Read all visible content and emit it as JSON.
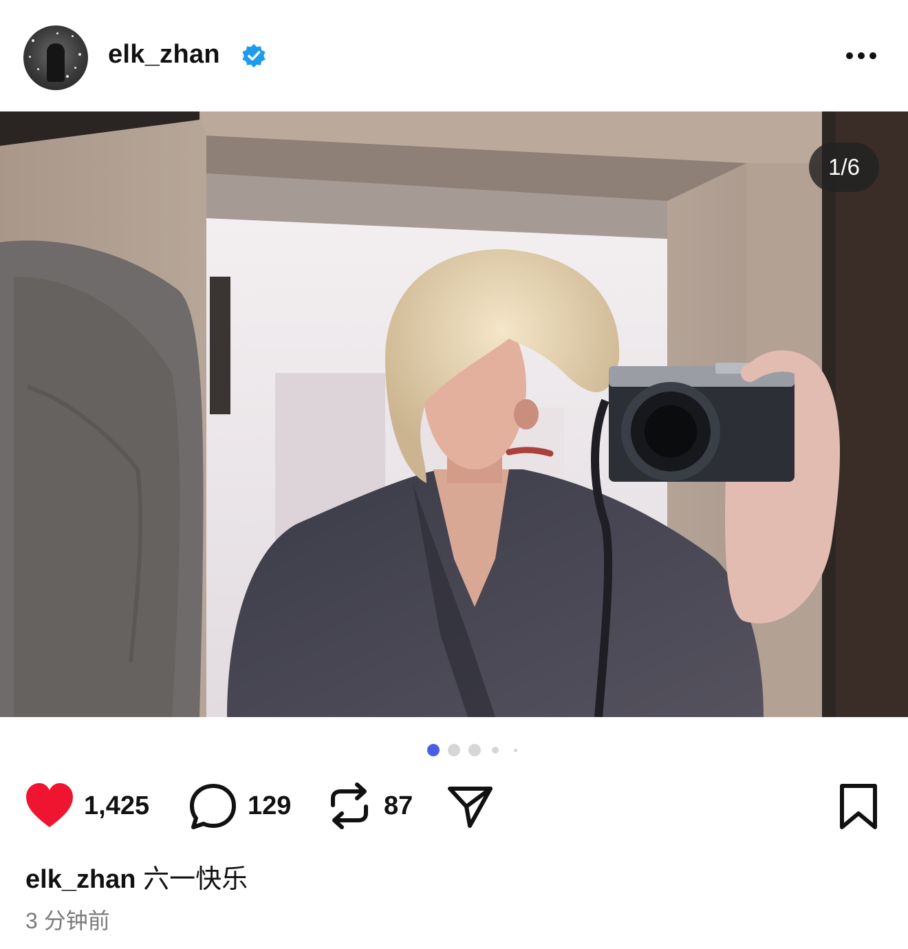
{
  "post": {
    "username": "elk_zhan",
    "verified": true,
    "avatar_icon": "avatar-icon",
    "more_icon": "more-options-icon"
  },
  "media": {
    "counter": "1/6",
    "current_index": 1,
    "total": 6,
    "description_icon": "photo-image"
  },
  "carousel": {
    "active_color": "#4a5de8",
    "inactive_color": "#d6d6d9"
  },
  "actions": {
    "like": {
      "icon": "heart-icon",
      "count": "1,425",
      "color": "#ef1530",
      "liked": true
    },
    "comment": {
      "icon": "comment-icon",
      "count": "129"
    },
    "repost": {
      "icon": "repost-icon",
      "count": "87"
    },
    "share": {
      "icon": "send-icon"
    },
    "save": {
      "icon": "bookmark-icon"
    }
  },
  "caption": {
    "username": "elk_zhan",
    "text": "六一快乐"
  },
  "timestamp": "3 分钟前"
}
